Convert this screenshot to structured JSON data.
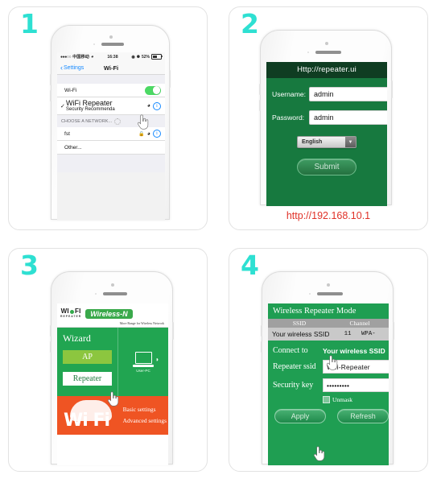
{
  "steps": [
    {
      "number": "1"
    },
    {
      "number": "2"
    },
    {
      "number": "3"
    },
    {
      "number": "4"
    }
  ],
  "colors": {
    "step_number": "#2ee0d2",
    "ios_blue": "#1589ff",
    "toggle_green": "#4cd964",
    "router_green": "#17793f",
    "wizard_green": "#21a551",
    "accent_orange": "#ef5423",
    "url_red": "#e03127",
    "ap_green": "#8cc63f"
  },
  "panel1": {
    "status_bar": {
      "signal_dots": "●●●○○",
      "carrier": "中国移动",
      "wifi_icon": "wifi-icon",
      "time": "16:38",
      "alarm_icon": "alarm-icon",
      "lock_rotation_icon": "rotation-lock-icon",
      "battery_percent": "52%"
    },
    "nav": {
      "back_label": "Settings",
      "title": "Wi-Fi"
    },
    "wifi_toggle_row": {
      "label": "Wi-Fi",
      "toggle_state": "on"
    },
    "connected_network": {
      "checkmark": "✓",
      "name": "WiFi Repeater",
      "subtitle": "Security Recommenda",
      "wifi_icon": "wifi-icon",
      "info_icon": "i"
    },
    "section_header": "CHOOSE A NETWORK...",
    "networks": [
      {
        "name": "fst",
        "lock_icon": "lock-icon",
        "wifi_icon": "wifi-icon",
        "info_icon": "i"
      },
      {
        "name": "Other...",
        "lock_icon": "",
        "wifi_icon": "",
        "info_icon": ""
      }
    ]
  },
  "panel2": {
    "address_bar": "Http://repeater.ui",
    "fields": [
      {
        "label": "Username:",
        "value": "admin",
        "placeholder": "Username"
      },
      {
        "label": "Password:",
        "value": "admin",
        "placeholder": "Password"
      }
    ],
    "language_select": {
      "value": "English",
      "arrow": "▼",
      "options": [
        "English"
      ]
    },
    "submit_label": "Submit",
    "url_note": "http://192.168.10.1"
  },
  "panel3": {
    "logo": {
      "top_left": "WI",
      "top_right": "FI",
      "subtitle": "REPEATER",
      "badge": "Wireless-N"
    },
    "tagline": "More Range for Wireless Network",
    "wizard_title": "Wizard",
    "buttons": [
      {
        "label": "AP",
        "style": "ap"
      },
      {
        "label": "Repeater",
        "style": "repeater"
      }
    ],
    "device": {
      "icon": "laptop-icon",
      "label": "User-PC",
      "signal_glyph": "◗"
    },
    "footer": {
      "brand": "Wi Fi",
      "links": [
        "Basic settings",
        "Advanced settings"
      ]
    }
  },
  "panel4": {
    "title": "Wireless Repeater Mode",
    "table": {
      "columns": [
        "SSID",
        "Channel"
      ],
      "rows": [
        {
          "ssid": "Your wireless SSID",
          "channel": "11",
          "security": "WPA-"
        }
      ]
    },
    "connect_to": {
      "label": "Connect to",
      "value": "Your wireless SSID"
    },
    "fields": [
      {
        "label": "Repeater ssid",
        "value": "Wifi-Repeater",
        "placeholder": "Repeater ssid"
      },
      {
        "label": "Security key",
        "value": "•••••••••",
        "placeholder": "Security key"
      }
    ],
    "unmask": {
      "label": "Unmask",
      "checked": false
    },
    "buttons": [
      {
        "label": "Apply"
      },
      {
        "label": "Refresh"
      }
    ]
  }
}
